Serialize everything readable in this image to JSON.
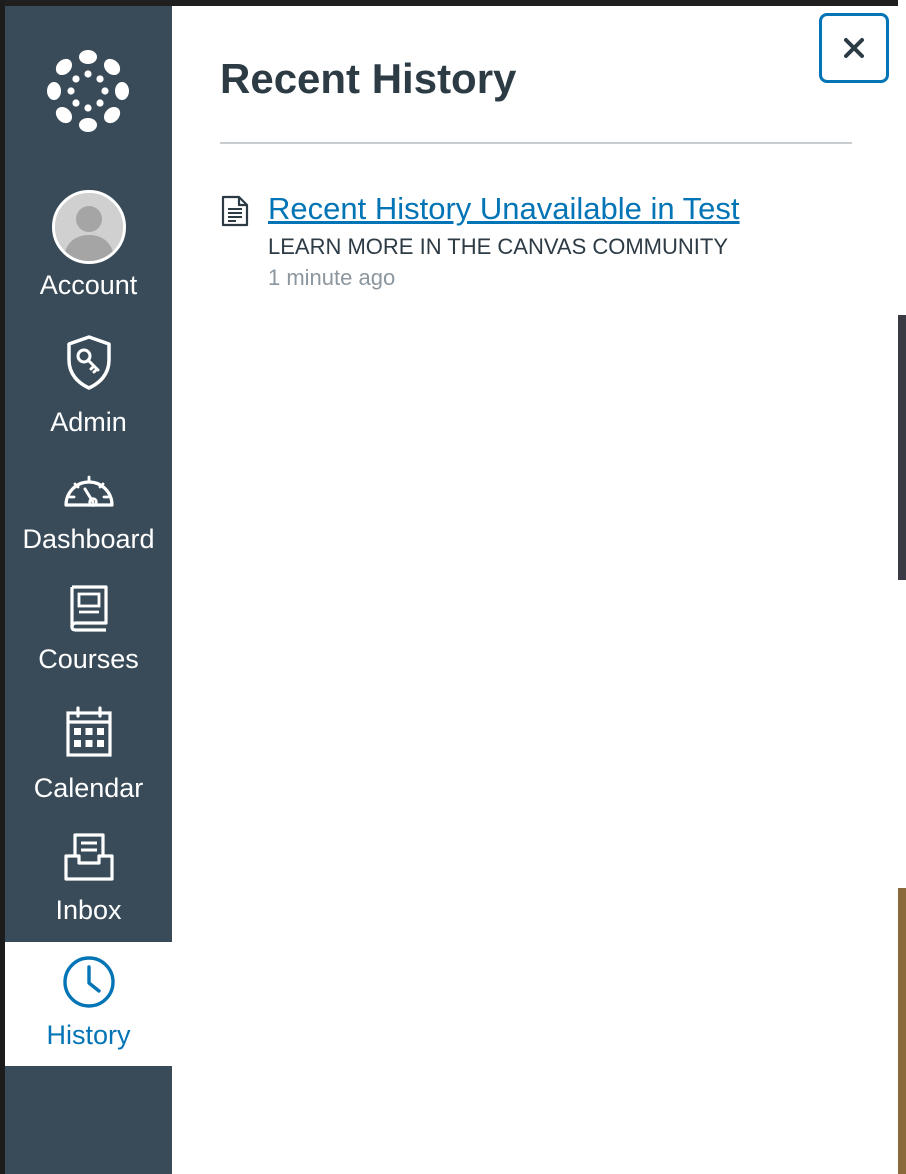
{
  "nav": {
    "items": [
      {
        "key": "account",
        "label": "Account",
        "icon": "avatar"
      },
      {
        "key": "admin",
        "label": "Admin",
        "icon": "admin-shield-key-icon"
      },
      {
        "key": "dashboard",
        "label": "Dashboard",
        "icon": "dashboard-gauge-icon"
      },
      {
        "key": "courses",
        "label": "Courses",
        "icon": "courses-book-icon"
      },
      {
        "key": "calendar",
        "label": "Calendar",
        "icon": "calendar-icon"
      },
      {
        "key": "inbox",
        "label": "Inbox",
        "icon": "inbox-icon"
      },
      {
        "key": "history",
        "label": "History",
        "icon": "clock-icon",
        "active": true
      }
    ],
    "background_color": "#394b58",
    "active_color": "#0374b5"
  },
  "tray": {
    "title": "Recent History",
    "close_icon": "close-icon",
    "items": [
      {
        "icon": "document-icon",
        "title": "Recent History Unavailable in Test",
        "subtitle": "LEARN MORE IN THE CANVAS COMMUNITY",
        "time": "1 minute ago"
      }
    ]
  }
}
